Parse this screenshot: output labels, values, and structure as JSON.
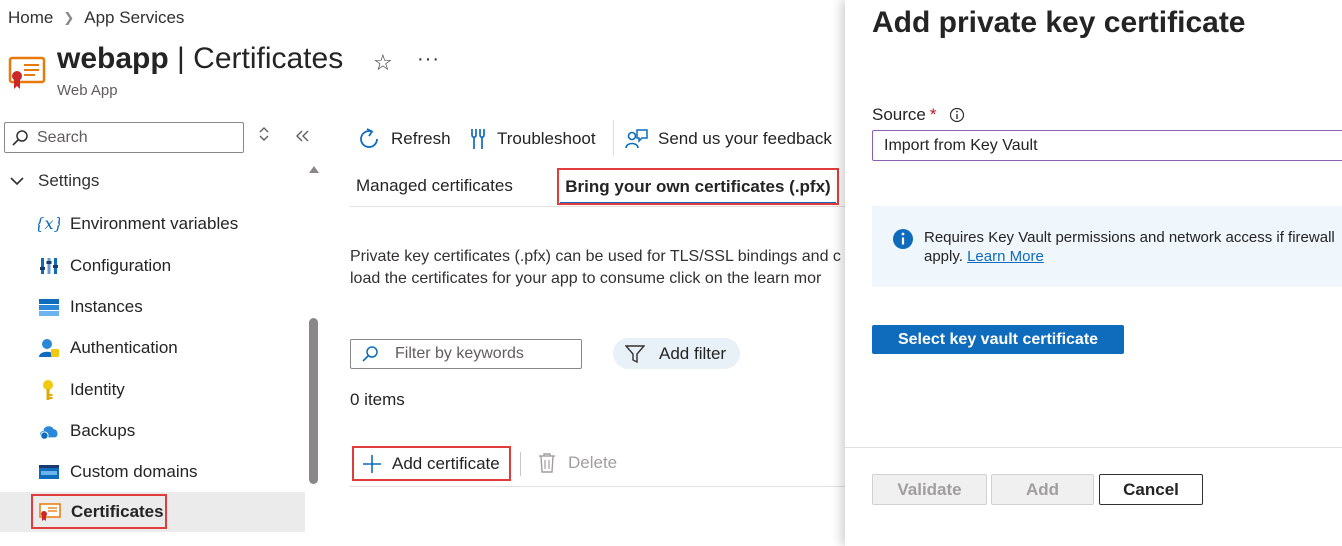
{
  "breadcrumb": {
    "home": "Home",
    "current": "App Services"
  },
  "header": {
    "resource_name": "webapp",
    "separator": " | ",
    "page": "Certificates",
    "subtitle": "Web App",
    "star_glyph": "☆",
    "more_glyph": "···"
  },
  "sidebar": {
    "search_placeholder": "Search",
    "group": "Settings",
    "items": [
      {
        "label": "Environment variables",
        "icon": "variable-icon"
      },
      {
        "label": "Configuration",
        "icon": "configuration-icon"
      },
      {
        "label": "Instances",
        "icon": "instances-icon"
      },
      {
        "label": "Authentication",
        "icon": "authentication-icon"
      },
      {
        "label": "Identity",
        "icon": "identity-key-icon"
      },
      {
        "label": "Backups",
        "icon": "backups-cloud-icon"
      },
      {
        "label": "Custom domains",
        "icon": "custom-domains-icon"
      },
      {
        "label": "Certificates",
        "icon": "certificate-icon"
      }
    ]
  },
  "toolbar": {
    "refresh": "Refresh",
    "troubleshoot": "Troubleshoot",
    "feedback": "Send us your feedback"
  },
  "tabs": {
    "managed": "Managed certificates",
    "byo": "Bring your own certificates (.pfx)"
  },
  "description": {
    "line1": "Private key certificates (.pfx) can be used for TLS/SSL bindings and c",
    "line2": "load the certificates for your app to consume click on the learn mor"
  },
  "filter": {
    "placeholder": "Filter by keywords",
    "add_filter": "Add filter"
  },
  "items_count": "0 items",
  "actions": {
    "add_certificate": "Add certificate",
    "delete": "Delete"
  },
  "panel": {
    "title": "Add private key certificate",
    "source_label": "Source",
    "required_mark": "*",
    "source_value": "Import from Key Vault",
    "info_text_line1": "Requires Key Vault permissions and network access if firewall",
    "info_text_line2": "apply.",
    "info_link": "Learn More",
    "select_button": "Select key vault certificate",
    "validate": "Validate",
    "add": "Add",
    "cancel": "Cancel"
  },
  "colors": {
    "accent": "#0f6cbd",
    "highlight_border": "#e03c3c",
    "required": "#c50f1f"
  }
}
